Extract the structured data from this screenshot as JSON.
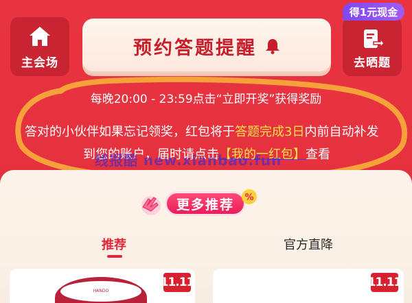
{
  "top_bar": {
    "left_button": {
      "label": "主会场",
      "icon": "home-icon"
    },
    "center_button": {
      "label": "预约答题提醒",
      "icon": "bell-icon"
    },
    "right_button": {
      "label": "去晒题",
      "icon": "share-doc-icon"
    },
    "cash_badge": "得1元现金"
  },
  "notice": {
    "line1": "每晚20:00 - 23:59点击“立即开奖”获得奖励",
    "line2_prefix": "答对的小伙伴如果忘记领奖，红包将于",
    "line2_highlight": "答题完成3日",
    "line2_suffix": "内前自动补发",
    "line3_prefix": "到您的账户，届时请点击",
    "line3_link": "【我的一红包】",
    "line3_suffix": "查看",
    "watermark": "线报酷 new.xianbao.fun"
  },
  "more_section": {
    "title": "更多推荐"
  },
  "tabs": [
    {
      "label": "推荐",
      "active": true
    },
    {
      "label": "官方直降",
      "active": false
    }
  ],
  "products": [
    {
      "badge": "11.11",
      "brand_text": "HANDO"
    },
    {
      "badge": "11.11"
    }
  ],
  "colors": {
    "background_red": "#e8303f",
    "accent_red": "#c81e2c",
    "highlight_yellow": "#ffe14a",
    "pill_pink": "#e81f5b",
    "badge_purple": "#7e49f2"
  }
}
